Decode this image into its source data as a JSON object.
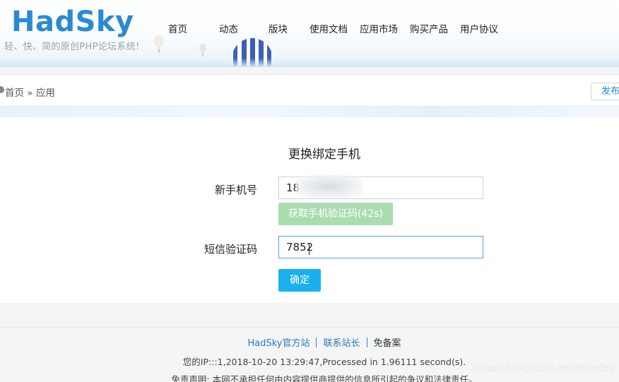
{
  "header": {
    "logo": "HadSky",
    "slogan": "轻、快、简的原创PHP论坛系统!",
    "nav": [
      {
        "label": "首页"
      },
      {
        "label": "动态"
      },
      {
        "label": "版块"
      },
      {
        "label": "使用文档"
      },
      {
        "label": "应用市场"
      },
      {
        "label": "购买产品"
      },
      {
        "label": "用户协议"
      }
    ]
  },
  "breadcrumb": {
    "home": "首页",
    "separator": "»",
    "current": "应用",
    "publish_label": "发布"
  },
  "form": {
    "title": "更换绑定手机",
    "phone_label": "新手机号",
    "phone_value": "18",
    "sms_button_label": "获取手机验证码(42s)",
    "code_label": "短信验证码",
    "code_value": "7852",
    "submit_label": "确定"
  },
  "footer": {
    "links": [
      {
        "label": "HadSky官方站"
      },
      {
        "label": "联系站长"
      }
    ],
    "record": "免备案",
    "ip_line": "您的IP:::1,2018-10-20 13:29:47,Processed in 1.96111 second(s).",
    "disclaimer": "免责声明: 本网不承担任何由内容提供商提供的信息所引起的争议和法律责任。"
  },
  "watermark": "https://blog.csdn.net/mindev",
  "colors": {
    "brand_blue": "#2a8ad1",
    "sms_button_disabled": "#aadcaf",
    "submit_button": "#1ab0ef",
    "focus_border": "#4aa8e0"
  }
}
